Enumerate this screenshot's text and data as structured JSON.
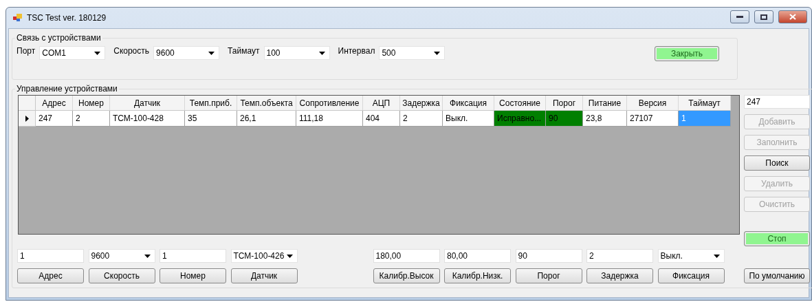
{
  "window": {
    "title": "TSC Test ver. 180129"
  },
  "connection": {
    "title": "Связь с устройствами",
    "fields": [
      {
        "label": "Порт",
        "value": "COM1"
      },
      {
        "label": "Скорость",
        "value": "9600"
      },
      {
        "label": "Таймаут",
        "value": "100"
      },
      {
        "label": "Интервал",
        "value": "500"
      }
    ],
    "button": {
      "label": "Закрыть",
      "color": "#90f590"
    }
  },
  "devices": {
    "title": "Управление устройствами",
    "table": {
      "columns": [
        "Адрес",
        "Номер",
        "Датчик",
        "Темп.приб.",
        "Темп.объекта",
        "Сопротивление",
        "АЦП",
        "Задержка",
        "Фиксация",
        "Состояние",
        "Порог",
        "Питание",
        "Версия",
        "Таймаут"
      ],
      "rows": [
        {
          "current": true,
          "cells": [
            {
              "text": "247",
              "selected": false
            },
            {
              "text": "2",
              "selected": false
            },
            {
              "text": "ТСМ-100-428",
              "selected": false
            },
            {
              "text": "35",
              "selected": false
            },
            {
              "text": "26,1",
              "selected": false
            },
            {
              "text": "111,18",
              "selected": false
            },
            {
              "text": "404",
              "selected": false
            },
            {
              "text": "2",
              "selected": false
            },
            {
              "text": "Выкл.",
              "selected": false
            },
            {
              "text": "Исправно...",
              "selected": false,
              "color": "#007f00"
            },
            {
              "text": "90",
              "selected": false,
              "color": "#007f00"
            },
            {
              "text": "23,8",
              "selected": false
            },
            {
              "text": "27107",
              "selected": false
            },
            {
              "text": "1",
              "selected": true
            }
          ]
        }
      ]
    },
    "side": {
      "value": "247",
      "buttons": [
        {
          "label": "Добавить",
          "disabled": true
        },
        {
          "label": "Заполнить",
          "disabled": true
        },
        {
          "label": "Поиск",
          "disabled": false
        },
        {
          "label": "Удалить",
          "disabled": true
        },
        {
          "label": "Очистить",
          "disabled": true
        }
      ],
      "stop": {
        "label": "Стоп",
        "color": "#90f590"
      },
      "default_button": "По умолчанию"
    },
    "settings": [
      {
        "kind": "input",
        "value": "1",
        "button": "Адрес"
      },
      {
        "kind": "combo",
        "value": "9600",
        "button": "Скорость"
      },
      {
        "kind": "input",
        "value": "1",
        "button": "Номер"
      },
      {
        "kind": "combo",
        "value": "ТСМ-100-426",
        "button": "Датчик"
      },
      {
        "kind": "blank"
      },
      {
        "kind": "input",
        "value": "180,00",
        "button": "Калибр.Высок"
      },
      {
        "kind": "input",
        "value": "80,00",
        "button": "Калибр.Низк."
      },
      {
        "kind": "input",
        "value": "90",
        "button": "Порог"
      },
      {
        "kind": "input",
        "value": "2",
        "button": "Задержка"
      },
      {
        "kind": "combo",
        "value": "Выкл.",
        "button": "Фиксация"
      }
    ]
  }
}
